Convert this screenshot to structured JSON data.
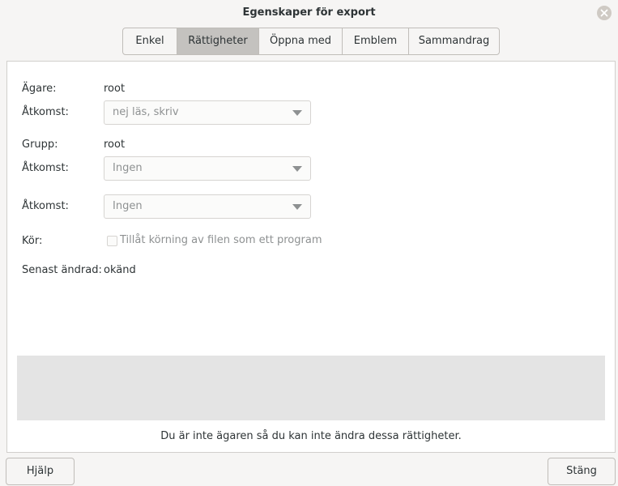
{
  "window": {
    "title": "Egenskaper för export"
  },
  "tabs": [
    {
      "label": "Enkel",
      "active": false
    },
    {
      "label": "Rättigheter",
      "active": true
    },
    {
      "label": "Öppna med",
      "active": false
    },
    {
      "label": "Emblem",
      "active": false
    },
    {
      "label": "Sammandrag",
      "active": false
    }
  ],
  "permissions": {
    "owner_label": "Ägare:",
    "owner_value": "root",
    "owner_access_label": "Åtkomst:",
    "owner_access_value": "nej läs, skriv",
    "group_label": "Grupp:",
    "group_value": "root",
    "group_access_label": "Åtkomst:",
    "group_access_value": "Ingen",
    "other_access_label": "Åtkomst:",
    "other_access_value": "Ingen",
    "execute_label": "Kör:",
    "execute_checkbox_label": "Tillåt körning av filen som ett program",
    "execute_checked": false,
    "modified_label": "Senast ändrad:",
    "modified_value": "okänd",
    "notice": "Du är inte ägaren så du kan inte ändra dessa rättigheter."
  },
  "footer": {
    "help_label": "Hjälp",
    "close_label": "Stäng"
  },
  "icons": {
    "close": "close-icon",
    "dropdown": "chevron-down-icon"
  }
}
